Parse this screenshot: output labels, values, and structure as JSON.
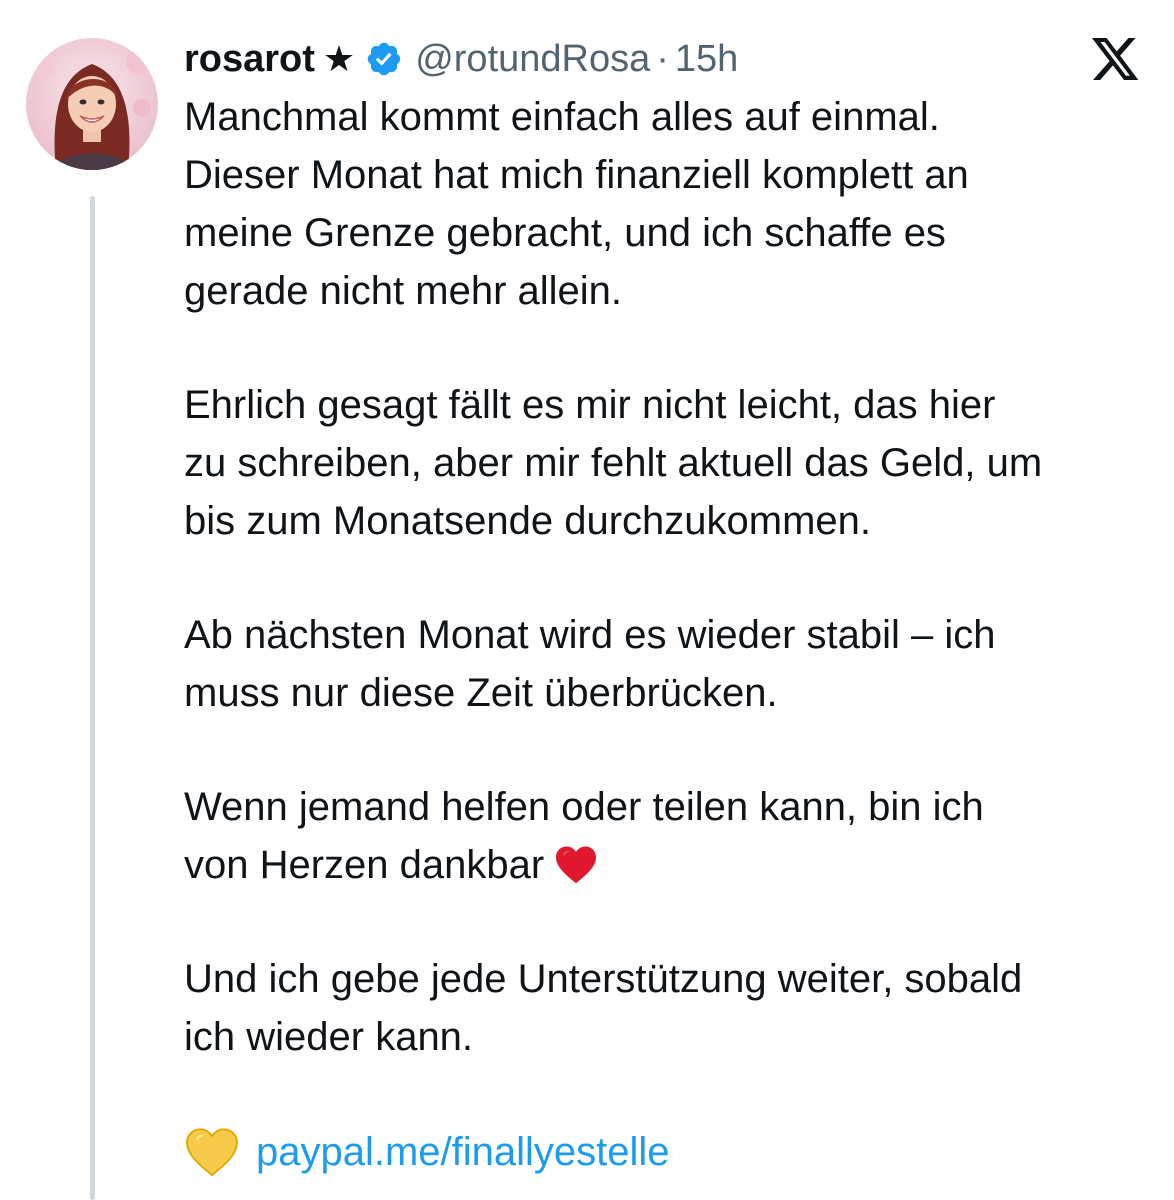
{
  "user": {
    "display_name": "rosarot",
    "name_symbol": "★",
    "handle": "@rotundRosa",
    "separator": "·",
    "time": "15h"
  },
  "icons": {
    "verified": "verified-badge-icon",
    "logo": "x-logo-icon",
    "heart": "red-heart-icon",
    "link_heart": "yellow-heart-icon"
  },
  "colors": {
    "verified": "#1d9bf0",
    "link": "#1d9bf0",
    "muted": "#536471",
    "text": "#0f1419"
  },
  "tweet": {
    "paragraphs": [
      "Manchmal kommt einfach alles auf einmal.\nDieser Monat hat mich finanziell komplett an\nmeine Grenze gebracht, und ich schaffe es\ngerade nicht mehr allein.",
      "Ehrlich gesagt fällt es mir nicht leicht, das hier\nzu schreiben, aber mir fehlt aktuell das Geld, um\nbis zum Monatsende durchzukommen.",
      "Ab nächsten Monat wird es wieder stabil – ich\nmuss nur diese Zeit überbrücken.",
      "Wenn jemand helfen oder teilen kann, bin ich\nvon Herzen dankbar",
      "Und ich gebe jede Unterstützung weiter, sobald\nich wieder kann."
    ],
    "link_text": "paypal.me/finallyestelle"
  }
}
